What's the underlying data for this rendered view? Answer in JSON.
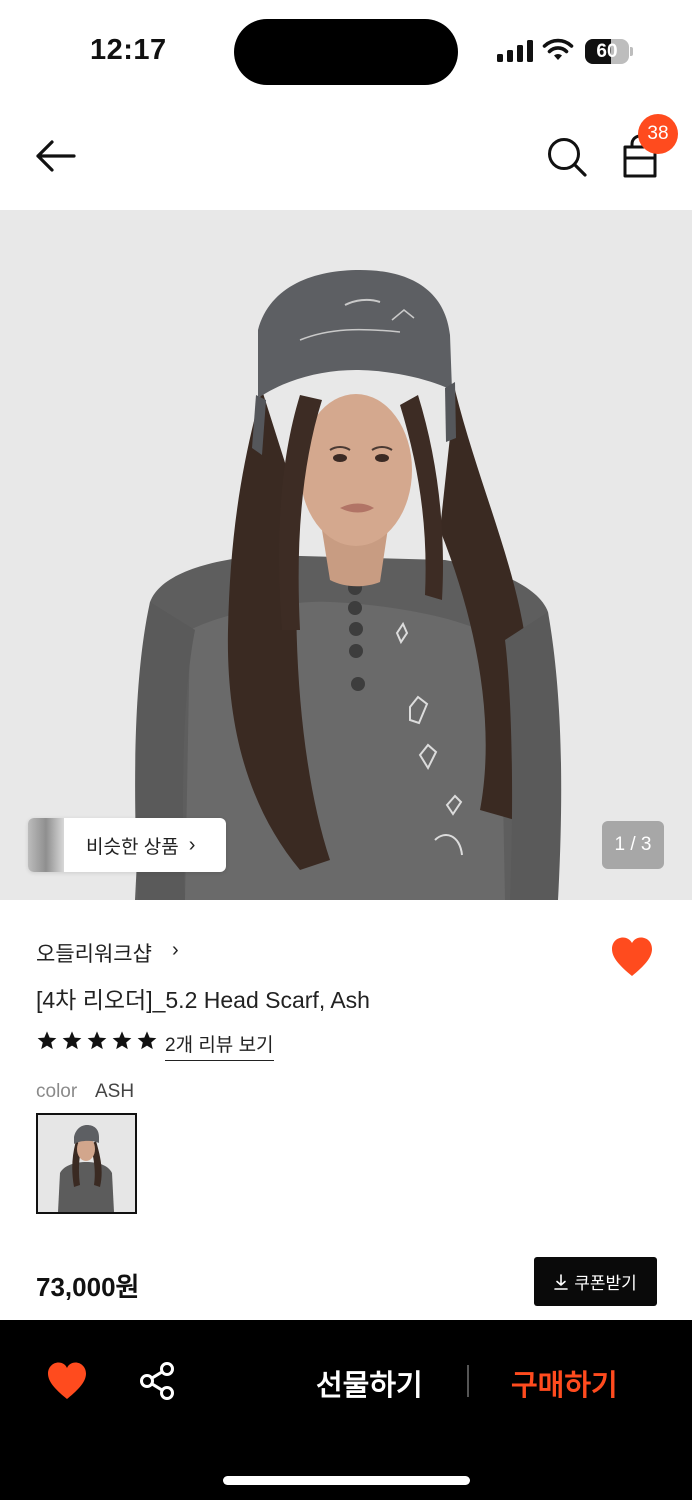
{
  "status_bar": {
    "time": "12:17",
    "battery": "60",
    "battery_level": 0.6
  },
  "top_nav": {
    "cart_count": "38"
  },
  "gallery": {
    "similar_label": "비슷한 상품",
    "counter": "1 / 3"
  },
  "product": {
    "brand": "오들리워크샵",
    "title": "[4차 리오더]_5.2 Head Scarf, Ash",
    "rating": 5,
    "review_link": "2개 리뷰 보기",
    "color_key": "color",
    "color_value": "ASH",
    "price": "73,000원",
    "coupon_label": "쿠폰받기"
  },
  "bottom_bar": {
    "gift_label": "선물하기",
    "buy_label": "구매하기"
  },
  "colors": {
    "accent": "#ff4b1e",
    "bottom_bar": "#000000",
    "image_bg": "#e8e8e8"
  },
  "icons": {
    "back": "arrow-left-icon",
    "search": "search-icon",
    "bag": "shopping-bag-icon",
    "heart": "heart-icon",
    "share": "share-icon",
    "star": "star-icon",
    "download": "download-icon"
  }
}
